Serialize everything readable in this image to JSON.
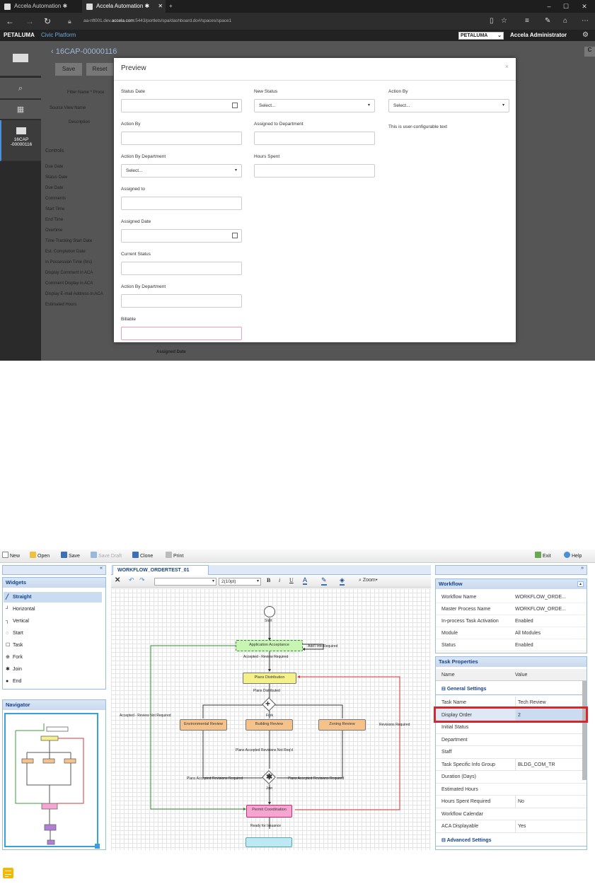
{
  "browser": {
    "tabs": [
      {
        "title": "Accela Automation"
      },
      {
        "title": "Accela Automation"
      }
    ],
    "new_tab": "+",
    "url_prefix": "aa-nft001.dev.",
    "url_domain": "accela.com",
    "url_suffix": ":5443/portlets/spa/dashboard.do#/spaces/space1"
  },
  "app": {
    "brand": "PETALUMA",
    "platform": "Civic Platform",
    "agency": "PETALUMA",
    "user": "Accela Administrator"
  },
  "sidebar": {
    "record_label": "16CAP",
    "record_id": "-00000116"
  },
  "record": {
    "title": "16CAP-00000116",
    "save": "Save",
    "reset": "Reset",
    "filter_name_label": "Filter Name",
    "filter_name_value": "Proce",
    "source_view_label": "Source View Name",
    "description_label": "Description",
    "controls_heading": "Controls",
    "controls": [
      "Due Date",
      "Status Date",
      "Due Date",
      "Comments",
      "Start Time",
      "End Time",
      "Overtime",
      "Time Tracking Start Date",
      "Est. Completion Date",
      "In Possession Time (hrs)",
      "Display Comment in ACA",
      "Comment Display in ACA",
      "Display E-mail Address in ACA",
      "Estimated Hours"
    ],
    "assigned_date_bg": "Assigned Date"
  },
  "preview": {
    "title": "Preview",
    "close": "×",
    "col1": [
      {
        "label": "Status Date",
        "type": "date"
      },
      {
        "label": "Action By",
        "type": "text"
      },
      {
        "label": "Action By Department",
        "type": "select",
        "value": "Select..."
      },
      {
        "label": "Assigned to",
        "type": "text"
      },
      {
        "label": "Assigned Date",
        "type": "date"
      },
      {
        "label": "Current Status",
        "type": "text"
      },
      {
        "label": "Action By Department",
        "type": "text"
      },
      {
        "label": "Billable",
        "type": "text"
      }
    ],
    "col2": [
      {
        "label": "New Status",
        "type": "select",
        "value": "Select..."
      },
      {
        "label": "Assigned to Department",
        "type": "text"
      },
      {
        "label": "Hours Spent",
        "type": "text"
      }
    ],
    "col3": [
      {
        "label": "Action By",
        "type": "select",
        "value": "Select..."
      }
    ],
    "config_text": "This is user-configurable text"
  },
  "designer": {
    "toolbar": {
      "new": "New",
      "open": "Open",
      "save": "Save",
      "save_draft": "Save Draft",
      "clone": "Clone",
      "print": "Print",
      "exit": "Exit",
      "help": "Help"
    },
    "widgets_title": "Widgets",
    "widgets": [
      "Straight",
      "Horizontal",
      "Vertical",
      "Start",
      "Task",
      "Fork",
      "Join",
      "End"
    ],
    "navigator_title": "Navigator",
    "tab_title": "WORKFLOW_ORDERTEST_01",
    "font_size": "2(10pt)",
    "zoom": "Zoom",
    "diagram": {
      "start": "Start",
      "app_acceptance": "Application Acceptance",
      "addl_info": "Add'l Info Required",
      "accepted_review": "Accepted - Review Required",
      "plans_distribution": "Plans Distribution",
      "plans_distributed": "Plans Distributed",
      "fork": "Fork",
      "accepted_no_review": "Accepted - Review Not Required",
      "env_review": "Environmental Review",
      "bldg_review": "Building Review",
      "zoning_review": "Zoning Review",
      "revisions_required": "Revisions Required",
      "plans_accepted_rev_not": "Plans Accepted Revisions Not Req'd",
      "plans_accepted_rev_req_left": "Plans Accepted Revisions Required",
      "plans_accepted_rev_req_right": "Plans Accepted Revisions Required",
      "join": "Join",
      "permit_coordination": "Permit Coordination",
      "ready_for_issuance": "Ready for Issuance"
    },
    "workflow_panel": {
      "title": "Workflow",
      "rows": [
        {
          "k": "Workflow Name",
          "v": "WORKFLOW_ORDE..."
        },
        {
          "k": "Master Process Name",
          "v": "WORKFLOW_ORDE..."
        },
        {
          "k": "In-process Task Activation",
          "v": "Enabled"
        },
        {
          "k": "Module",
          "v": "All Modules"
        },
        {
          "k": "Status",
          "v": "Enabled"
        }
      ]
    },
    "task_panel": {
      "title": "Task Properties",
      "col_name": "Name",
      "col_value": "Value",
      "general": "General Settings",
      "rows": [
        {
          "k": "Task Name",
          "v": "Tech Review"
        },
        {
          "k": "Display Order",
          "v": "2"
        },
        {
          "k": "Initial Status",
          "v": ""
        },
        {
          "k": "Department",
          "v": ""
        },
        {
          "k": "Staff",
          "v": ""
        },
        {
          "k": "Task Specific Info Group",
          "v": "BLDG_COM_TR"
        },
        {
          "k": "Duration (Days)",
          "v": ""
        },
        {
          "k": "Estimated Hours",
          "v": ""
        },
        {
          "k": "Hours Spent Required",
          "v": "No"
        },
        {
          "k": "Workflow Calendar",
          "v": ""
        },
        {
          "k": "ACA Displayable",
          "v": "Yes"
        }
      ],
      "advanced": "Advanced Settings"
    }
  },
  "colors": {
    "highlight": "#d9262c",
    "accent": "#15428b"
  }
}
